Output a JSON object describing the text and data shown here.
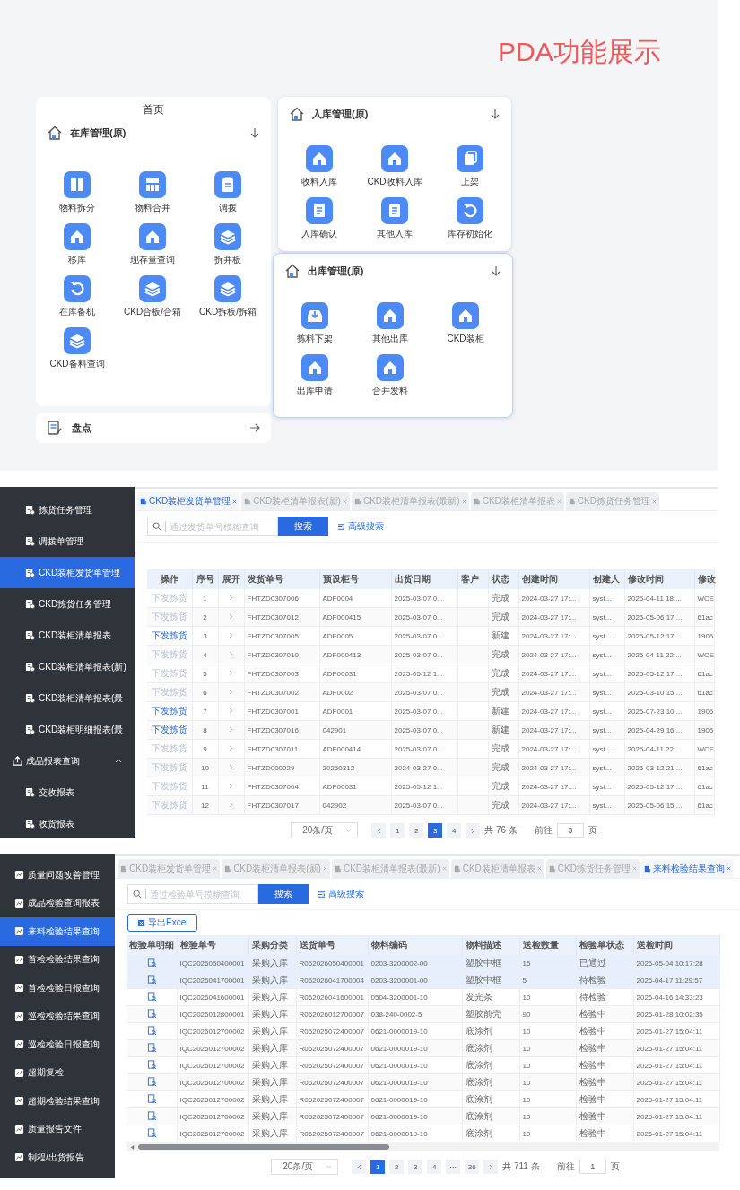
{
  "pda_showcase": {
    "title": "PDA功能展示",
    "home": {
      "title": "首页",
      "section": {
        "title": "在库管理(原)",
        "items": [
          "物料拆分",
          "物料合并",
          "调拨",
          "移库",
          "现存量查询",
          "拆并板",
          "在库备机",
          "CKD合板/合箱",
          "CKD拆板/拆箱",
          "CKD备料查询"
        ]
      },
      "stocktake": {
        "title": "盘点"
      }
    },
    "inbound": {
      "title": "入库管理(原)",
      "items": [
        "收料入库",
        "CKD收料入库",
        "上架",
        "入库确认",
        "其他入库",
        "库存初始化"
      ]
    },
    "outbound": {
      "title": "出库管理(原)",
      "items": [
        "拣料下架",
        "其他出库",
        "CKD装柜",
        "出库申请",
        "合并发料"
      ]
    }
  },
  "shipping_screen": {
    "sidebar": {
      "items": [
        {
          "kind": "link",
          "label": "拣货任务管理",
          "selected": false
        },
        {
          "kind": "link",
          "label": "调拨单管理",
          "selected": false
        },
        {
          "kind": "link",
          "label": "CKD装柜发货单管理",
          "selected": true
        },
        {
          "kind": "link",
          "label": "CKD拣货任务管理",
          "selected": false
        },
        {
          "kind": "link",
          "label": "CKD装柜清单报表",
          "selected": false
        },
        {
          "kind": "link",
          "label": "CKD装柜清单报表(新)",
          "selected": false
        },
        {
          "kind": "link",
          "label": "CKD装柜清单报表(最",
          "selected": false
        },
        {
          "kind": "link",
          "label": "CKD装柜明细报表(最",
          "selected": false
        },
        {
          "kind": "group",
          "label": "成品报表查询",
          "selected": false,
          "expanded": true,
          "children": [
            {
              "kind": "link",
              "label": "交收报表",
              "selected": false
            },
            {
              "kind": "link",
              "label": "收货报表",
              "selected": false
            }
          ]
        }
      ]
    },
    "tabs": [
      {
        "label": "CKD装柜发货单管理",
        "selected": true
      },
      {
        "label": "CKD装柜清单报表(新)",
        "selected": false
      },
      {
        "label": "CKD装柜清单报表(最新)",
        "selected": false
      },
      {
        "label": "CKD装柜清单报表",
        "selected": false
      },
      {
        "label": "CKD拣货任务管理",
        "selected": false
      }
    ],
    "search": {
      "placeholder": "通过发货单号模糊查询",
      "button": "搜索",
      "advanced": "高级搜索"
    },
    "table": {
      "columns": [
        "操作",
        "序号",
        "展开",
        "发货单号",
        "预设柜号",
        "出货日期",
        "客户",
        "状态",
        "创建时间",
        "创建人",
        "修改时间",
        "修改"
      ],
      "rows": [
        {
          "action": "下发拣货",
          "disabled": true,
          "no": "1",
          "shipment_no": "FHTZD0307006",
          "cabinet_no": "ADF0004",
          "ship_date": "2025-03-07 0...",
          "status": "完成",
          "created": "2024-03-27 17:...",
          "creator": "syst...",
          "modified": "2025-04-11 18:...",
          "modifier": "WCE"
        },
        {
          "action": "下发拣货",
          "disabled": true,
          "no": "2",
          "shipment_no": "FHTZD0307012",
          "cabinet_no": "ADF000415",
          "ship_date": "2025-03-07 0...",
          "status": "完成",
          "created": "2024-03-27 17:...",
          "creator": "syst...",
          "modified": "2025-05-06 17:...",
          "modifier": "61ac"
        },
        {
          "action": "下发拣货",
          "disabled": false,
          "no": "3",
          "shipment_no": "FHTZD0307005",
          "cabinet_no": "ADF0005",
          "ship_date": "2025-03-07 0...",
          "status": "新建",
          "created": "2024-03-27 17:...",
          "creator": "syst...",
          "modified": "2025-05-12 17:...",
          "modifier": "1905"
        },
        {
          "action": "下发拣货",
          "disabled": true,
          "no": "4",
          "shipment_no": "FHTZD0307010",
          "cabinet_no": "ADF000413",
          "ship_date": "2025-03-07 0...",
          "status": "完成",
          "created": "2024-03-27 17:...",
          "creator": "syst...",
          "modified": "2025-04-11 22:...",
          "modifier": "WCE"
        },
        {
          "action": "下发拣货",
          "disabled": true,
          "no": "5",
          "shipment_no": "FHTZD0307003",
          "cabinet_no": "ADF00031",
          "ship_date": "2025-05-12 1...",
          "status": "完成",
          "created": "2024-03-27 17:...",
          "creator": "syst...",
          "modified": "2025-05-12 17:...",
          "modifier": "61ac"
        },
        {
          "action": "下发拣货",
          "disabled": true,
          "no": "6",
          "shipment_no": "FHTZD0307002",
          "cabinet_no": "ADF0002",
          "ship_date": "2025-03-07 0...",
          "status": "完成",
          "created": "2024-03-27 17:...",
          "creator": "syst...",
          "modified": "2025-03-10 15:...",
          "modifier": "61ac"
        },
        {
          "action": "下发拣货",
          "disabled": false,
          "no": "7",
          "shipment_no": "FHTZD0307001",
          "cabinet_no": "ADF0001",
          "ship_date": "2025-03-07 0...",
          "status": "新建",
          "created": "2024-03-27 17:...",
          "creator": "syst...",
          "modified": "2025-07-23 10:...",
          "modifier": "1905"
        },
        {
          "action": "下发拣货",
          "disabled": false,
          "no": "8",
          "shipment_no": "FHTZD0307016",
          "cabinet_no": "042901",
          "ship_date": "2025-03-07 0...",
          "status": "新建",
          "created": "2024-03-27 17:...",
          "creator": "syst...",
          "modified": "2025-04-29 16:...",
          "modifier": "1905"
        },
        {
          "action": "下发拣货",
          "disabled": true,
          "no": "9",
          "shipment_no": "FHTZD0307011",
          "cabinet_no": "ADF000414",
          "ship_date": "2025-03-07 0...",
          "status": "完成",
          "created": "2024-03-27 17:...",
          "creator": "syst...",
          "modified": "2025-04-11 22:...",
          "modifier": "WCE"
        },
        {
          "action": "下发拣货",
          "disabled": true,
          "no": "10",
          "shipment_no": "FHTZD000029",
          "cabinet_no": "20250312",
          "ship_date": "2024-03-27 0...",
          "status": "完成",
          "created": "2024-03-27 17:...",
          "creator": "syst...",
          "modified": "2025-03-12 21:...",
          "modifier": "61ac"
        },
        {
          "action": "下发拣货",
          "disabled": true,
          "no": "11",
          "shipment_no": "FHTZD0307004",
          "cabinet_no": "ADF00031",
          "ship_date": "2025-05-12 1...",
          "status": "完成",
          "created": "2024-03-27 17:...",
          "creator": "syst...",
          "modified": "2025-05-12 17:...",
          "modifier": "61ac"
        },
        {
          "action": "下发拣货",
          "disabled": true,
          "no": "12",
          "shipment_no": "FHTZD0307017",
          "cabinet_no": "042902",
          "ship_date": "2025-03-07 0...",
          "status": "完成",
          "created": "2024-03-27 17:...",
          "creator": "syst...",
          "modified": "2025-05-06 15:...",
          "modifier": "61ac"
        }
      ]
    },
    "pagination": {
      "page_size": "20条/页",
      "pages": [
        {
          "label": "1",
          "selected": false
        },
        {
          "label": "2",
          "selected": false
        },
        {
          "label": "3",
          "selected": true
        },
        {
          "label": "4",
          "selected": false
        }
      ],
      "total": "共 76 条",
      "goto_label": "前往",
      "goto_value": "3",
      "goto_suffix": "页"
    }
  },
  "inspection_screen": {
    "sidebar": {
      "items": [
        {
          "label": "质量问题改善管理",
          "selected": false
        },
        {
          "label": "成品检验查询报表",
          "selected": false
        },
        {
          "label": "来料检验结果查询",
          "selected": true
        },
        {
          "label": "首检检验结果查询",
          "selected": false
        },
        {
          "label": "首检检验日报查询",
          "selected": false
        },
        {
          "label": "巡检检验结果查询",
          "selected": false
        },
        {
          "label": "巡检检验日报查询",
          "selected": false
        },
        {
          "label": "超期复检",
          "selected": false
        },
        {
          "label": "超期检验结果查询",
          "selected": false
        },
        {
          "label": "质量报告文件",
          "selected": false
        },
        {
          "label": "制程/出货报告",
          "selected": false
        }
      ]
    },
    "tabs": [
      {
        "label": "CKD装柜发货单管理",
        "selected": false
      },
      {
        "label": "CKD装柜清单报表(新)",
        "selected": false
      },
      {
        "label": "CKD装柜清单报表(最新)",
        "selected": false
      },
      {
        "label": "CKD装柜清单报表",
        "selected": false
      },
      {
        "label": "CKD拣货任务管理",
        "selected": false
      },
      {
        "label": "来料检验结果查询",
        "selected": true
      }
    ],
    "search": {
      "placeholder": "通过检验单号模糊查询",
      "button": "搜索",
      "advanced": "高级搜索"
    },
    "export_button": "导出Excel",
    "table": {
      "columns": [
        "检验单明细",
        "检验单号",
        "采购分类",
        "送货单号",
        "物料编码",
        "物料描述",
        "送检数量",
        "检验单状态",
        "送检时间"
      ],
      "rows": [
        {
          "selected": true,
          "cells": [
            "",
            "IQC2026050400001",
            "采购入库",
            "R062026050400001",
            "0203-3200002-00",
            "塑胶中框",
            "15",
            "已通过",
            "2026-05-04 10:17:28"
          ]
        },
        {
          "selected": true,
          "cells": [
            "",
            "IQC2026041700001",
            "采购入库",
            "R062026041700004",
            "0203-3200001-00",
            "塑胶中框",
            "5",
            "待检验",
            "2026-04-17 11:29:57"
          ]
        },
        {
          "selected": false,
          "cells": [
            "",
            "IQC2026041600001",
            "采购入库",
            "R062026041600001",
            "0504-3200001-10",
            "发光条",
            "10",
            "待检验",
            "2026-04-16 14:33:23"
          ]
        },
        {
          "selected": false,
          "cells": [
            "",
            "IQC2026012800001",
            "采购入库",
            "R062026012700007",
            "038-240-0002-5",
            "塑胶前壳",
            "90",
            "检验中",
            "2026-01-28 10:02:35"
          ]
        },
        {
          "selected": false,
          "cells": [
            "",
            "IQC2026012700002",
            "采购入库",
            "R062025072400007",
            "0621-0000019-10",
            "底涂剂",
            "10",
            "检验中",
            "2026-01-27 15:04:11"
          ]
        },
        {
          "selected": false,
          "cells": [
            "",
            "IQC2026012700002",
            "采购入库",
            "R062025072400007",
            "0621-0000019-10",
            "底涂剂",
            "10",
            "检验中",
            "2026-01-27 15:04:11"
          ]
        },
        {
          "selected": false,
          "cells": [
            "",
            "IQC2026012700002",
            "采购入库",
            "R062025072400007",
            "0621-0000019-10",
            "底涂剂",
            "10",
            "检验中",
            "2026-01-27 15:04:11"
          ]
        },
        {
          "selected": false,
          "cells": [
            "",
            "IQC2026012700002",
            "采购入库",
            "R062025072400007",
            "0621-0000019-10",
            "底涂剂",
            "10",
            "检验中",
            "2026-01-27 15:04:11"
          ]
        },
        {
          "selected": false,
          "cells": [
            "",
            "IQC2026012700002",
            "采购入库",
            "R062025072400007",
            "0621-0000019-10",
            "底涂剂",
            "10",
            "检验中",
            "2026-01-27 15:04:11"
          ]
        },
        {
          "selected": false,
          "cells": [
            "",
            "IQC2026012700002",
            "采购入库",
            "R062025072400007",
            "0621-0000019-10",
            "底涂剂",
            "10",
            "检验中",
            "2026-01-27 15:04:11"
          ]
        },
        {
          "selected": false,
          "cells": [
            "",
            "IQC2026012700002",
            "采购入库",
            "R062025072400007",
            "0621-0000019-10",
            "底涂剂",
            "10",
            "检验中",
            "2026-01-27 15:04:11"
          ]
        }
      ]
    },
    "pagination": {
      "page_size": "20条/页",
      "pages": [
        {
          "label": "1",
          "selected": true
        },
        {
          "label": "2",
          "selected": false
        },
        {
          "label": "3",
          "selected": false
        },
        {
          "label": "4",
          "selected": false
        },
        {
          "label": "···",
          "selected": false
        },
        {
          "label": "36",
          "selected": false
        }
      ],
      "total": "共 711 条",
      "goto_label": "前往",
      "goto_value": "1",
      "goto_suffix": "页"
    }
  }
}
